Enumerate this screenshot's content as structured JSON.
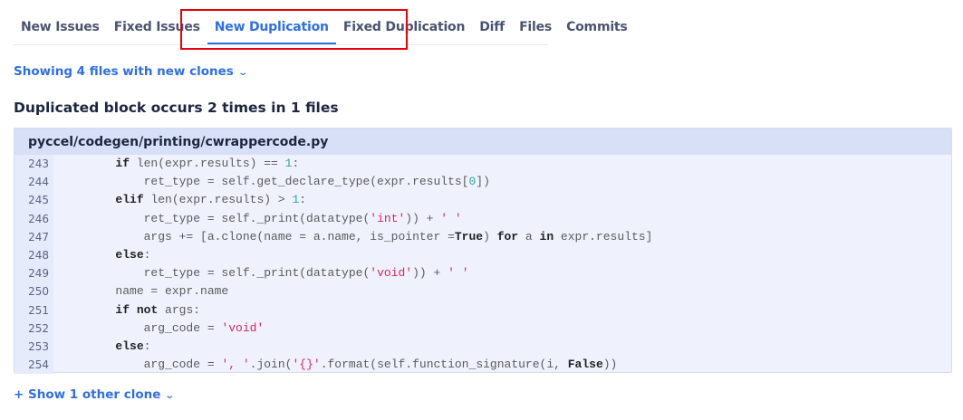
{
  "tabs": [
    {
      "label": "New Issues",
      "active": false
    },
    {
      "label": "Fixed Issues",
      "active": false
    },
    {
      "label": "New Duplication",
      "active": true
    },
    {
      "label": "Fixed Duplication",
      "active": false
    },
    {
      "label": "Diff",
      "active": false
    },
    {
      "label": "Files",
      "active": false
    },
    {
      "label": "Commits",
      "active": false
    }
  ],
  "highlight_color": "#e8000b",
  "accent_color": "#2f6fe4",
  "showing_label": "Showing 4 files with new clones",
  "heading": "Duplicated block occurs 2 times in 1 files",
  "file": {
    "path": "pyccel/codegen/printing/cwrappercode.py",
    "lines": [
      {
        "n": "243",
        "tokens": [
          [
            "t",
            "        "
          ],
          [
            "kw",
            "if"
          ],
          [
            "t",
            " len(expr.results) == "
          ],
          [
            "num",
            "1"
          ],
          [
            "t",
            ":"
          ]
        ]
      },
      {
        "n": "244",
        "tokens": [
          [
            "t",
            "            ret_type = self.get_declare_type(expr.results["
          ],
          [
            "num",
            "0"
          ],
          [
            "t",
            "])"
          ]
        ]
      },
      {
        "n": "245",
        "tokens": [
          [
            "t",
            "        "
          ],
          [
            "kw",
            "elif"
          ],
          [
            "t",
            " len(expr.results) > "
          ],
          [
            "num",
            "1"
          ],
          [
            "t",
            ":"
          ]
        ]
      },
      {
        "n": "246",
        "tokens": [
          [
            "t",
            "            ret_type = self._print(datatype("
          ],
          [
            "str",
            "'int'"
          ],
          [
            "t",
            ")) + "
          ],
          [
            "str",
            "' '"
          ]
        ]
      },
      {
        "n": "247",
        "tokens": [
          [
            "t",
            "            args += [a.clone(name = a.name, is_pointer ="
          ],
          [
            "kw",
            "True"
          ],
          [
            "t",
            ") "
          ],
          [
            "kw",
            "for"
          ],
          [
            "t",
            " a "
          ],
          [
            "kw",
            "in"
          ],
          [
            "t",
            " expr.results]"
          ]
        ]
      },
      {
        "n": "248",
        "tokens": [
          [
            "t",
            "        "
          ],
          [
            "kw",
            "else"
          ],
          [
            "t",
            ":"
          ]
        ]
      },
      {
        "n": "249",
        "tokens": [
          [
            "t",
            "            ret_type = self._print(datatype("
          ],
          [
            "str",
            "'void'"
          ],
          [
            "t",
            ")) + "
          ],
          [
            "str",
            "' '"
          ]
        ]
      },
      {
        "n": "250",
        "tokens": [
          [
            "t",
            "        name = expr.name"
          ]
        ]
      },
      {
        "n": "251",
        "tokens": [
          [
            "t",
            "        "
          ],
          [
            "kw",
            "if"
          ],
          [
            "t",
            " "
          ],
          [
            "kw",
            "not"
          ],
          [
            "t",
            " args:"
          ]
        ]
      },
      {
        "n": "252",
        "tokens": [
          [
            "t",
            "            arg_code = "
          ],
          [
            "str",
            "'void'"
          ]
        ]
      },
      {
        "n": "253",
        "tokens": [
          [
            "t",
            "        "
          ],
          [
            "kw",
            "else"
          ],
          [
            "t",
            ":"
          ]
        ]
      },
      {
        "n": "254",
        "tokens": [
          [
            "t",
            "            arg_code = "
          ],
          [
            "str",
            "', '"
          ],
          [
            "t",
            ".join("
          ],
          [
            "str",
            "'{}'"
          ],
          [
            "t",
            ".format(self.function_signature(i, "
          ],
          [
            "kw",
            "False"
          ],
          [
            "t",
            "))"
          ]
        ]
      }
    ]
  },
  "show_other_label": "+ Show 1 other clone"
}
